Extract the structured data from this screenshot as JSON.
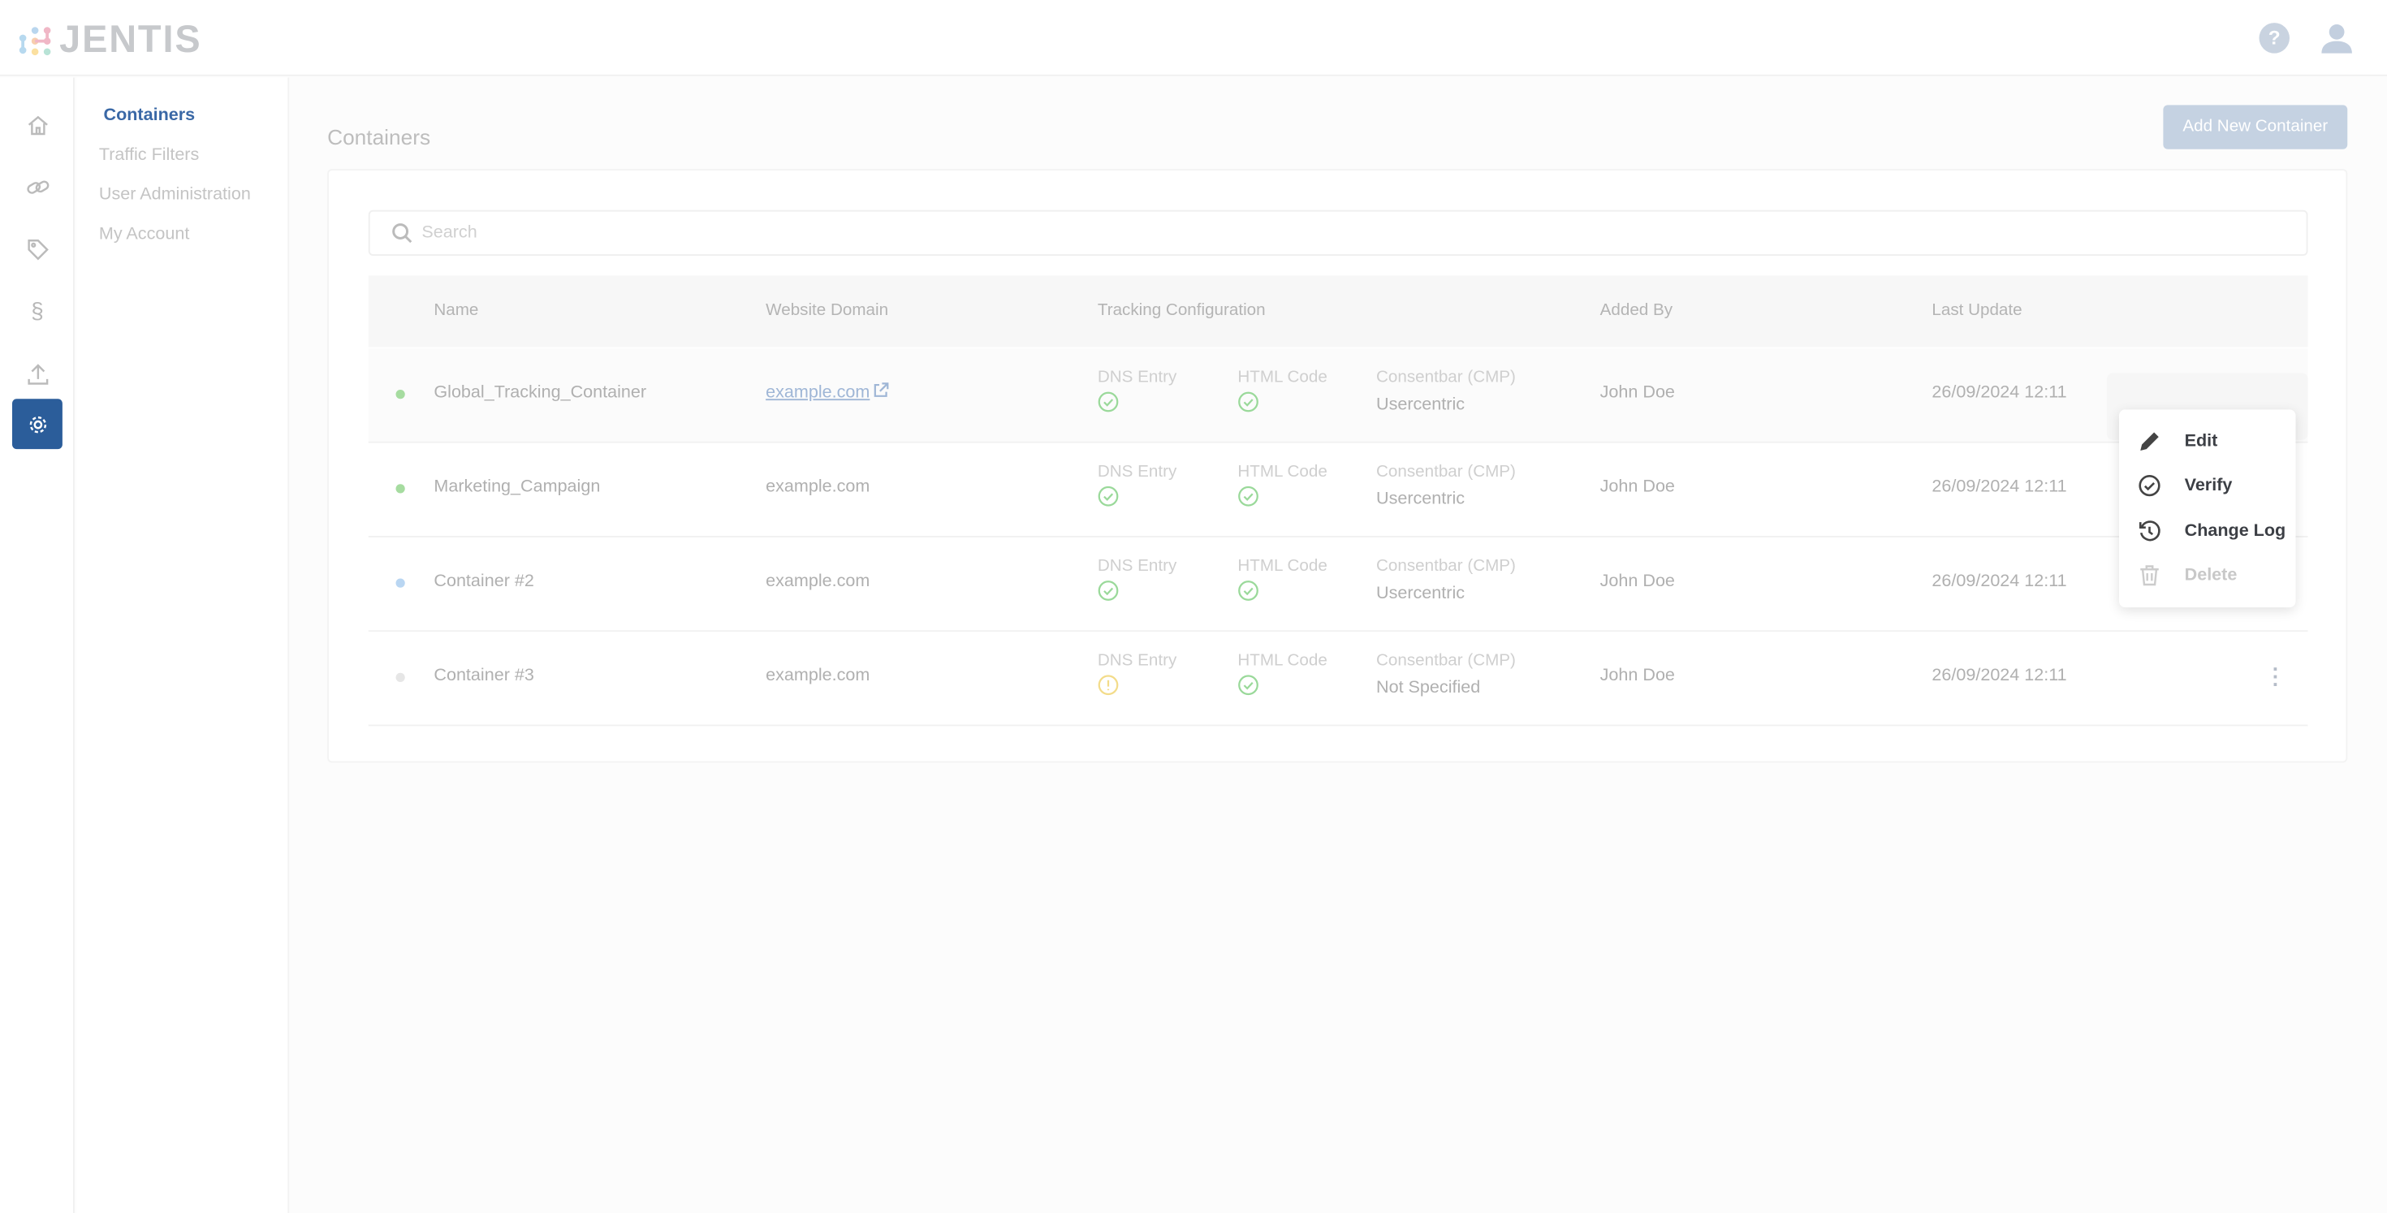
{
  "app": {
    "logo_text": "JENTIS"
  },
  "header": {
    "help_label": "?"
  },
  "rail": [
    "home-icon",
    "link-icon",
    "tag-icon",
    "section-icon",
    "upload-icon",
    "gear-icon"
  ],
  "subnav": {
    "items": [
      {
        "label": "Containers",
        "active": true
      },
      {
        "label": "Traffic Filters"
      },
      {
        "label": "User Administration"
      },
      {
        "label": "My Account"
      }
    ]
  },
  "page": {
    "title": "Containers",
    "add_button": "Add New Container"
  },
  "search": {
    "placeholder": "Search",
    "value": ""
  },
  "table": {
    "headers": [
      "Name",
      "Website Domain",
      "Tracking Configuration",
      "Added By",
      "Last Update"
    ],
    "rows": [
      {
        "status_color": "#a6dca0",
        "name": "Global_Tracking_Container",
        "domain": "example.com",
        "dns_label": "DNS Entry",
        "dns_status": "ok",
        "html_label": "HTML Code",
        "html_status": "ok",
        "cmp_label": "Consentbar (CMP)",
        "cmp_value": "Usercentric",
        "added_by": "John Doe",
        "last_update": "26/09/2024 12:11"
      },
      {
        "status_color": "#a6dca0",
        "name": "Marketing_Campaign",
        "domain": "example.com",
        "dns_label": "DNS Entry",
        "dns_status": "ok",
        "html_label": "HTML Code",
        "html_status": "ok",
        "cmp_label": "Consentbar (CMP)",
        "cmp_value": "Usercentric",
        "added_by": "John Doe",
        "last_update": "26/09/2024 12:11"
      },
      {
        "status_color": "#b9d6f2",
        "name": "Container #2",
        "domain": "example.com",
        "dns_label": "DNS Entry",
        "dns_status": "ok",
        "html_label": "HTML Code",
        "html_status": "ok",
        "cmp_label": "Consentbar (CMP)",
        "cmp_value": "Usercentric",
        "added_by": "John Doe",
        "last_update": "26/09/2024 12:11"
      },
      {
        "status_color": "#e6e6e6",
        "name": "Container #3",
        "domain": "example.com",
        "dns_label": "DNS Entry",
        "dns_status": "warning",
        "html_label": "HTML Code",
        "html_status": "ok",
        "cmp_label": "Consentbar (CMP)",
        "cmp_value": "Not Specified",
        "added_by": "John Doe",
        "last_update": "26/09/2024 12:11"
      }
    ]
  },
  "context_menu": {
    "items": [
      {
        "label": "Edit",
        "icon": "pencil-icon"
      },
      {
        "label": "Verify",
        "icon": "check-circle-icon"
      },
      {
        "label": "Change Log",
        "icon": "history-icon"
      },
      {
        "label": "Delete",
        "icon": "trash-icon",
        "disabled": true
      }
    ]
  },
  "colors": {
    "accent": "#2b5d9a",
    "ok": "#9ad99a",
    "warning": "#f3dc8a"
  }
}
